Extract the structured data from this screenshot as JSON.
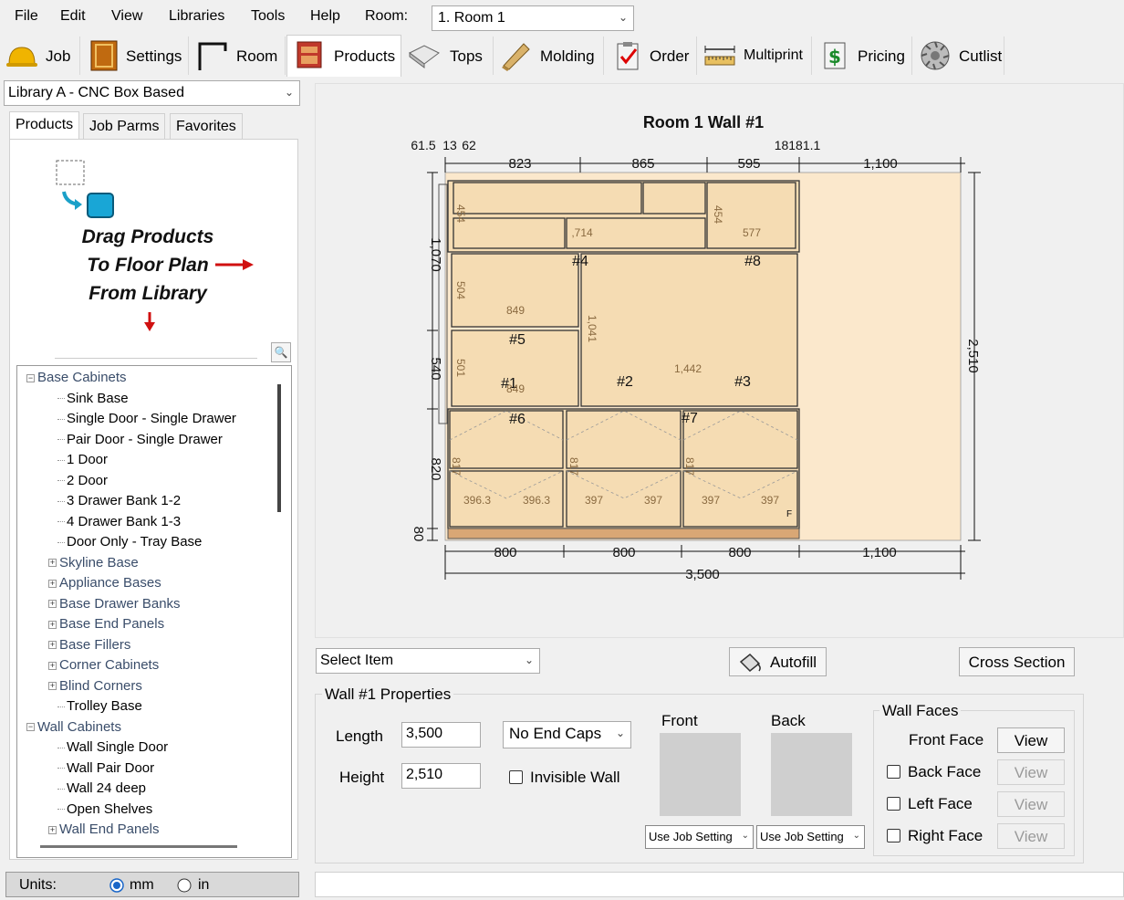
{
  "menu": {
    "items": [
      "File",
      "Edit",
      "View",
      "Libraries",
      "Tools",
      "Help"
    ],
    "room_label": "Room:",
    "room_value": "1. Room 1"
  },
  "tabs": [
    {
      "label": "Job",
      "icon": "hardhat-icon"
    },
    {
      "label": "Settings",
      "icon": "cabinet-door-icon"
    },
    {
      "label": "Room",
      "icon": "room-walls-icon"
    },
    {
      "label": "Products",
      "icon": "products-icon",
      "active": true
    },
    {
      "label": "Tops",
      "icon": "countertop-icon"
    },
    {
      "label": "Molding",
      "icon": "molding-icon"
    },
    {
      "label": "Order",
      "icon": "clipboard-check-icon"
    },
    {
      "label": "Multiprint",
      "icon": "ruler-icon"
    },
    {
      "label": "Pricing",
      "icon": "pricing-icon"
    },
    {
      "label": "Cutlist",
      "icon": "saw-blade-icon"
    }
  ],
  "library": {
    "selected": "Library A - CNC Box Based",
    "subtabs": [
      "Products",
      "Job Parms",
      "Favorites"
    ],
    "drag_text": [
      "Drag Products",
      "To Floor Plan",
      "From Library"
    ]
  },
  "tree": [
    {
      "label": "Base Cabinets",
      "type": "group-open"
    },
    {
      "label": "Sink Base",
      "type": "leaf"
    },
    {
      "label": "Single Door - Single Drawer",
      "type": "leaf"
    },
    {
      "label": "Pair Door - Single Drawer",
      "type": "leaf"
    },
    {
      "label": "1 Door",
      "type": "leaf"
    },
    {
      "label": "2 Door",
      "type": "leaf"
    },
    {
      "label": "3 Drawer Bank 1-2",
      "type": "leaf"
    },
    {
      "label": "4 Drawer Bank 1-3",
      "type": "leaf"
    },
    {
      "label": "Door Only - Tray Base",
      "type": "leaf"
    },
    {
      "label": "Skyline Base",
      "type": "group-closed"
    },
    {
      "label": "Appliance Bases",
      "type": "group-closed"
    },
    {
      "label": "Base Drawer Banks",
      "type": "group-closed"
    },
    {
      "label": "Base End Panels",
      "type": "group-closed"
    },
    {
      "label": "Base Fillers",
      "type": "group-closed"
    },
    {
      "label": "Corner Cabinets",
      "type": "group-closed"
    },
    {
      "label": "Blind Corners",
      "type": "group-closed"
    },
    {
      "label": "Trolley Base",
      "type": "leaf"
    },
    {
      "label": "Wall Cabinets",
      "type": "group-open"
    },
    {
      "label": "Wall Single Door",
      "type": "leaf"
    },
    {
      "label": "Wall Pair Door",
      "type": "leaf"
    },
    {
      "label": "Wall 24 deep",
      "type": "leaf"
    },
    {
      "label": "Open Shelves",
      "type": "leaf"
    },
    {
      "label": "Wall End Panels",
      "type": "group-closed"
    }
  ],
  "units": {
    "label": "Units:",
    "options": [
      "mm",
      "in"
    ],
    "selected": "mm"
  },
  "elevation": {
    "title": "Room 1 Wall #1",
    "top_small": {
      "left": "61.5",
      "mid": "13",
      "right": "62",
      "right2": "18181.1"
    },
    "top_dims": [
      "823",
      "865",
      "595",
      "1,100"
    ],
    "bottom_dims": [
      "800",
      "800",
      "800",
      "1,100"
    ],
    "total": "3,500",
    "height": "2,510",
    "left_dims": [
      "1,070",
      "540",
      "820",
      "80"
    ],
    "labels": {
      "n1": "#1",
      "n2": "#2",
      "n3": "#3",
      "n4": "#4",
      "n5": "#5",
      "n6": "#6",
      "n7": "#7",
      "n8": "#8",
      "d454a": "454",
      "d454b": "454",
      "d714": ",714",
      "d577": "577",
      "d504": "504",
      "d849a": "849",
      "d1041": "1,041",
      "d501": "501",
      "d849b": "849",
      "d1442": "1,442",
      "d817a": "817",
      "d817b": "817",
      "d817c": "817",
      "w396a": "396.3",
      "w396b": "396.3",
      "w397a": "397",
      "w397b": "397",
      "w397c": "397",
      "w397d": "397",
      "f": "F"
    }
  },
  "controls": {
    "select_item": "Select Item",
    "autofill": "Autofill",
    "cross_section": "Cross Section"
  },
  "properties": {
    "title": "Wall #1 Properties",
    "length_label": "Length",
    "length_value": "3,500",
    "height_label": "Height",
    "height_value": "2,510",
    "end_caps": "No End Caps",
    "invisible_wall": "Invisible Wall",
    "front_label": "Front",
    "back_label": "Back",
    "front_setting": "Use Job Setting",
    "back_setting": "Use Job Setting"
  },
  "wall_faces": {
    "title": "Wall Faces",
    "items": [
      {
        "label": "Front Face",
        "checkbox": false,
        "enabled": true
      },
      {
        "label": "Back Face",
        "checkbox": true,
        "enabled": false
      },
      {
        "label": "Left Face",
        "checkbox": true,
        "enabled": false
      },
      {
        "label": "Right Face",
        "checkbox": true,
        "enabled": false
      }
    ],
    "view_label": "View"
  }
}
